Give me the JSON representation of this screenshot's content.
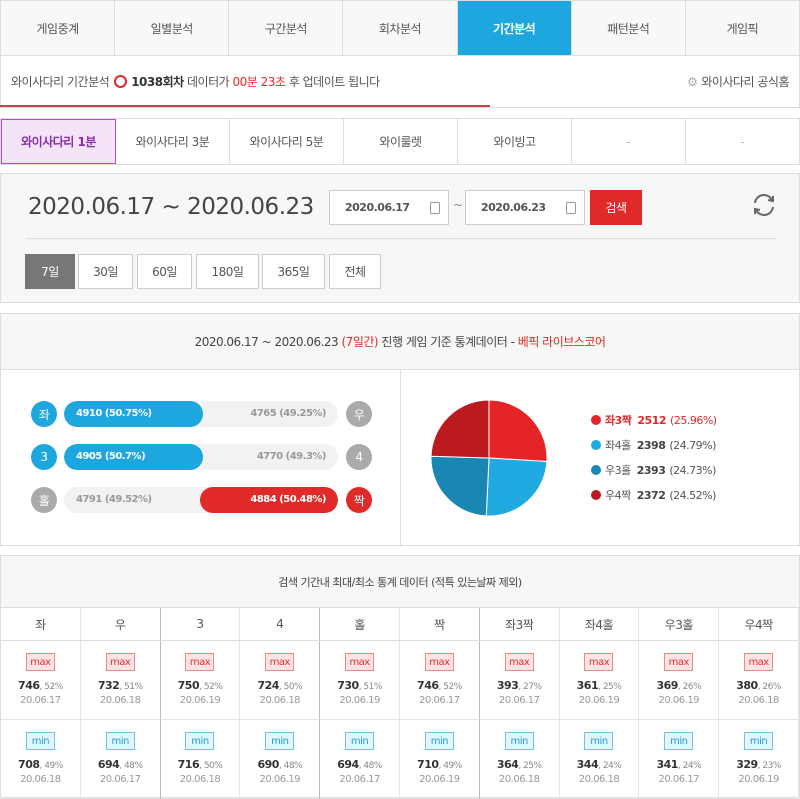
{
  "top_tabs": [
    {
      "label": "게임중계"
    },
    {
      "label": "일별분석"
    },
    {
      "label": "구간분석"
    },
    {
      "label": "회차분석"
    },
    {
      "label": "기간분석",
      "active": true
    },
    {
      "label": "패턴분석"
    },
    {
      "label": "게임픽"
    }
  ],
  "info": {
    "prefix": "와이사다리 기간분석",
    "round": "1038회차",
    "middle": "데이터가",
    "countdown": "00분 23초",
    "suffix": "후 업데이트 됩니다",
    "official_link": "와이사다리 공식홈"
  },
  "sub_tabs": [
    {
      "label": "와이사다리 1분",
      "active": true
    },
    {
      "label": "와이사다리 3분"
    },
    {
      "label": "와이사다리 5분"
    },
    {
      "label": "와이룰렛"
    },
    {
      "label": "와이빙고"
    },
    {
      "label": "-"
    },
    {
      "label": "-"
    }
  ],
  "date_range": {
    "title": "2020.06.17 ~ 2020.06.23",
    "from": "2020.06.17",
    "tilde": "~",
    "to": "2020.06.23",
    "search_label": "검색",
    "periods": [
      "7일",
      "30일",
      "60일",
      "180일",
      "365일",
      "전체"
    ],
    "active_period": "7일"
  },
  "stats": {
    "header_range": "2020.06.17 ~ 2020.06.23",
    "header_days": "(7일간)",
    "header_mid": "진행 게임 기준 통계데이터 -",
    "header_brand": "베픽 라이브스코어",
    "bars": [
      {
        "left_label": "좌",
        "left_text": "4910 (50.75%)",
        "left_pct": 50.75,
        "right_label": "우",
        "right_text": "4765 (49.25%)",
        "winner": "left",
        "color": "#1ea6df"
      },
      {
        "left_label": "3",
        "left_text": "4905 (50.7%)",
        "left_pct": 50.7,
        "right_label": "4",
        "right_text": "4770 (49.3%)",
        "winner": "left",
        "color": "#1ea6df"
      },
      {
        "left_label": "홀",
        "left_text": "4791 (49.52%)",
        "left_pct": 49.52,
        "right_label": "짝",
        "right_text": "4884 (50.48%)",
        "winner": "right",
        "color": "#e02a2a"
      }
    ],
    "pie": [
      {
        "label": "좌3짝",
        "value": 2512,
        "pct": "(25.96%)",
        "color": "#e52428",
        "highlight": true
      },
      {
        "label": "좌4홀",
        "value": 2398,
        "pct": "(24.79%)",
        "color": "#21a9e1"
      },
      {
        "label": "우3홀",
        "value": 2393,
        "pct": "(24.73%)",
        "color": "#1a86b4"
      },
      {
        "label": "우4짝",
        "value": 2372,
        "pct": "(24.52%)",
        "color": "#bb1b1f"
      }
    ]
  },
  "table": {
    "title": "검색 기간내 최대/최소 통계 데이터 (적특 있는날짜 제외)",
    "max_label": "max",
    "min_label": "min",
    "columns": [
      {
        "h": "좌",
        "max": "746",
        "maxp": ", 52%",
        "maxd": "20.06.17",
        "min": "708",
        "minp": ", 49%",
        "mind": "20.06.18"
      },
      {
        "h": "우",
        "max": "732",
        "maxp": ", 51%",
        "maxd": "20.06.18",
        "min": "694",
        "minp": ", 48%",
        "mind": "20.06.17"
      },
      {
        "h": "3",
        "max": "750",
        "maxp": ", 52%",
        "maxd": "20.06.19",
        "min": "716",
        "minp": ", 50%",
        "mind": "20.06.18"
      },
      {
        "h": "4",
        "max": "724",
        "maxp": ", 50%",
        "maxd": "20.06.18",
        "min": "690",
        "minp": ", 48%",
        "mind": "20.06.19"
      },
      {
        "h": "홀",
        "max": "730",
        "maxp": ", 51%",
        "maxd": "20.06.19",
        "min": "694",
        "minp": ", 48%",
        "mind": "20.06.17"
      },
      {
        "h": "짝",
        "max": "746",
        "maxp": ", 52%",
        "maxd": "20.06.17",
        "min": "710",
        "minp": ", 49%",
        "mind": "20.06.19"
      },
      {
        "h": "좌3짝",
        "max": "393",
        "maxp": ", 27%",
        "maxd": "20.06.17",
        "min": "364",
        "minp": ", 25%",
        "mind": "20.06.18"
      },
      {
        "h": "좌4홀",
        "max": "361",
        "maxp": ", 25%",
        "maxd": "20.06.19",
        "min": "344",
        "minp": ", 24%",
        "mind": "20.06.18"
      },
      {
        "h": "우3홀",
        "max": "369",
        "maxp": ", 26%",
        "maxd": "20.06.19",
        "min": "341",
        "minp": ", 24%",
        "mind": "20.06.17"
      },
      {
        "h": "우4짝",
        "max": "380",
        "maxp": ", 26%",
        "maxd": "20.06.18",
        "min": "329",
        "minp": ", 23%",
        "mind": "20.06.19"
      }
    ]
  }
}
